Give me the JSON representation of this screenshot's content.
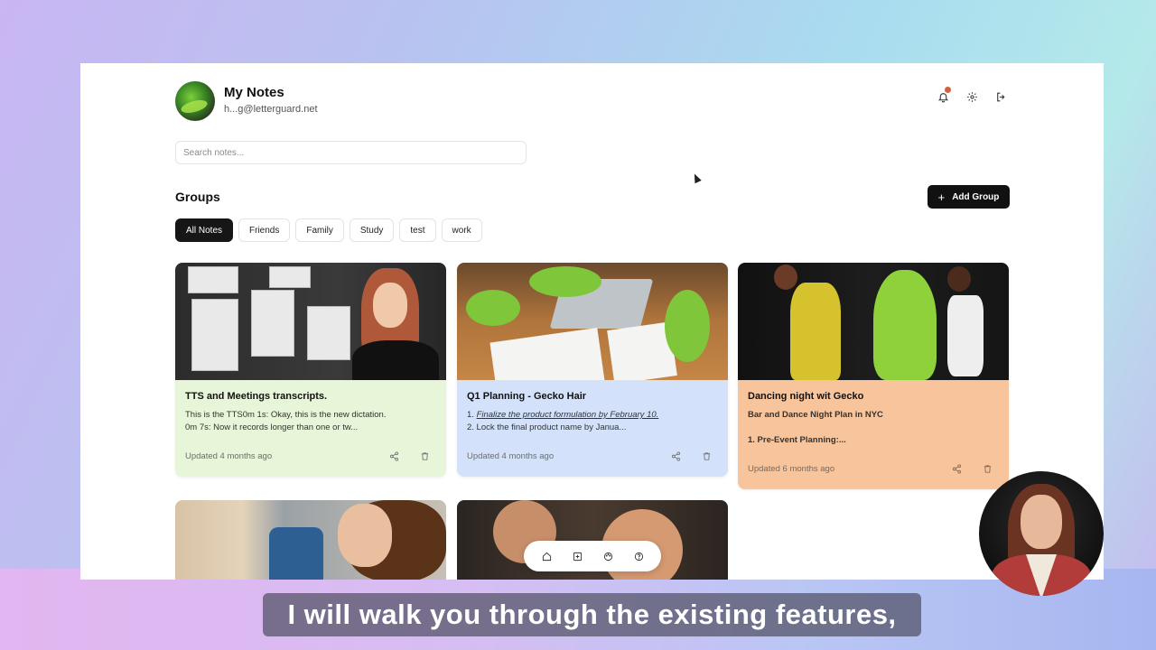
{
  "header": {
    "title": "My Notes",
    "email": "h...g@letterguard.net",
    "icons": [
      "bell-icon",
      "gear-icon",
      "logout-icon"
    ]
  },
  "search": {
    "placeholder": "Search notes..."
  },
  "groups": {
    "title": "Groups",
    "add_label": "Add Group",
    "chips": [
      "All Notes",
      "Friends",
      "Family",
      "Study",
      "test",
      "work"
    ],
    "active": "All Notes"
  },
  "notes": [
    {
      "title": "TTS and Meetings transcripts.",
      "line1": "This is the TTS0m 1s: Okay, this is the new dictation.",
      "line2": "0m 7s: Now it records longer than one or tw...",
      "updated": "Updated 4 months ago",
      "color": "#e7f5d8"
    },
    {
      "title": "Q1 Planning - Gecko Hair",
      "line1_prefix": "1. ",
      "line1_em": "Finalize the product formulation by February 10.",
      "line2": "2. Lock the final product name by Janua...",
      "updated": "Updated 4 months ago",
      "color": "#d3e2fa"
    },
    {
      "title": "Dancing night wit Gecko",
      "line1": "Bar and Dance Night Plan in NYC",
      "line2": "1. Pre-Event Planning:...",
      "updated": "Updated 6 months ago",
      "color": "#f8c49b"
    }
  ],
  "bottom_nav": [
    "home-icon",
    "add-note-icon",
    "palette-icon",
    "help-icon"
  ],
  "subtitle": "I will walk you through the existing features,"
}
